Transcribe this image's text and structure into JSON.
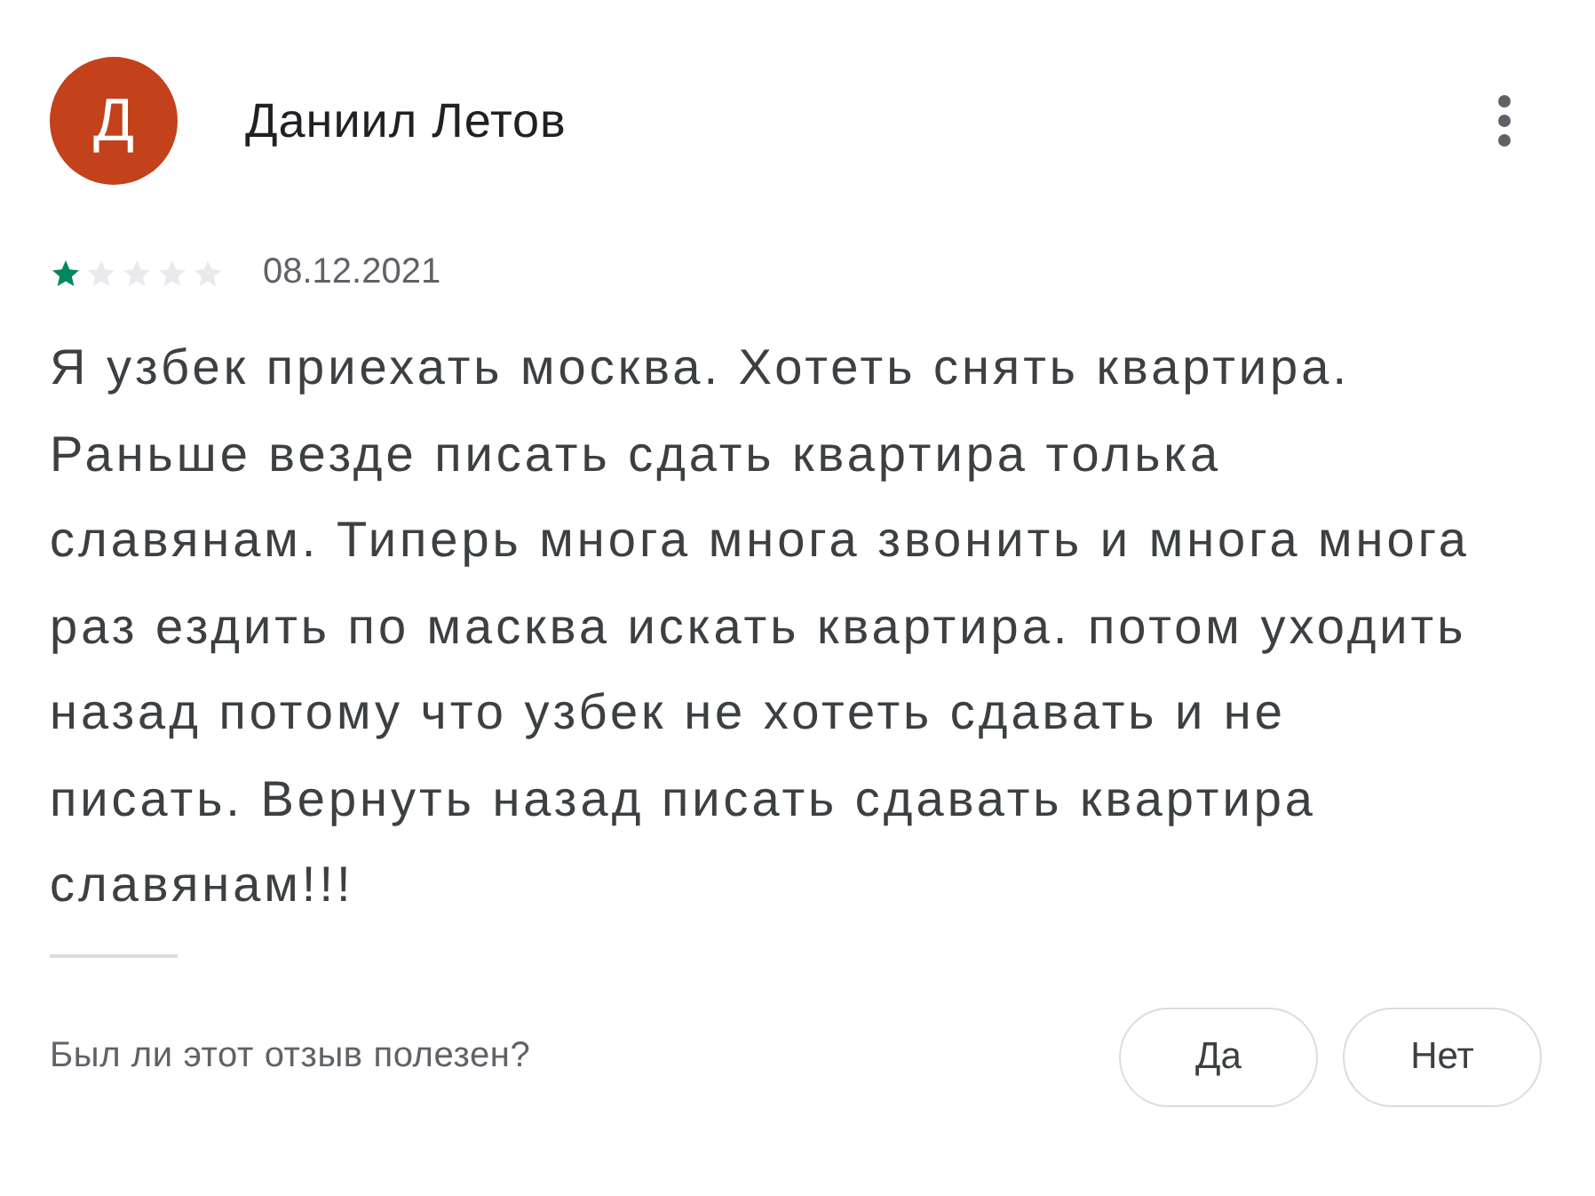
{
  "review": {
    "avatar_letter": "Д",
    "color": "#c3411b",
    "author": "Даниил Летов",
    "stars": 1,
    "date": "08.12.2021",
    "text": "Я узбек приехать москва. Хотеть снять квартира. Раньше везде писать сдать квартира толька славянам. Типерь многа многа звонить и многа многа раз ездить по масква искать квартира. потом уходить назад потому что узбек не хотеть сдавать и не писать. Вернуть назад писать сдавать квартира славянам!!!"
  },
  "helpful": {
    "question": "Был ли этот отзыв полезен?",
    "buttons": [
      "Да",
      "Нет"
    ]
  }
}
